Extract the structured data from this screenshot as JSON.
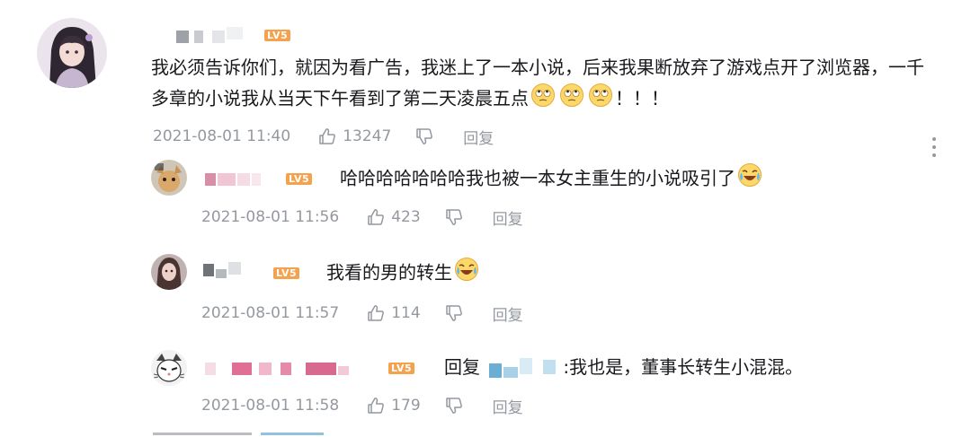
{
  "comments": {
    "main": {
      "level": "LV5",
      "text": "我必须告诉你们，就因为看广告，我迷上了一本小说，后来我果断放弃了游戏点开了浏览器，一千多章的小说我从当天下午看到了第二天凌晨五点",
      "text_tail": "！！！",
      "emoji_name": "rolling-eyes-emoji",
      "time": "2021-08-01 11:40",
      "likes": "13247",
      "reply_label": "回复"
    },
    "replies": [
      {
        "level": "LV5",
        "text": "哈哈哈哈哈哈哈我也被一本女主重生的小说吸引了",
        "emoji_name": "crying-laugh-emoji",
        "time": "2021-08-01 11:56",
        "likes": "423",
        "reply_label": "回复"
      },
      {
        "level": "LV5",
        "text": "我看的男的转生",
        "emoji_name": "crying-laugh-emoji",
        "time": "2021-08-01 11:57",
        "likes": "114",
        "reply_label": "回复"
      },
      {
        "level": "LV5",
        "reply_prefix": "回复",
        "text": ":我也是，董事长转生小混混。",
        "time": "2021-08-01 11:58",
        "likes": "179",
        "reply_label": "回复"
      }
    ]
  },
  "colors": {
    "level_badge": "#f4a24e",
    "text": "#18191c",
    "meta": "#9499a0",
    "username_pink": "#f0b8cc",
    "username_gray": "#c9cbd0",
    "mention_blue": "#8fc3e0"
  }
}
